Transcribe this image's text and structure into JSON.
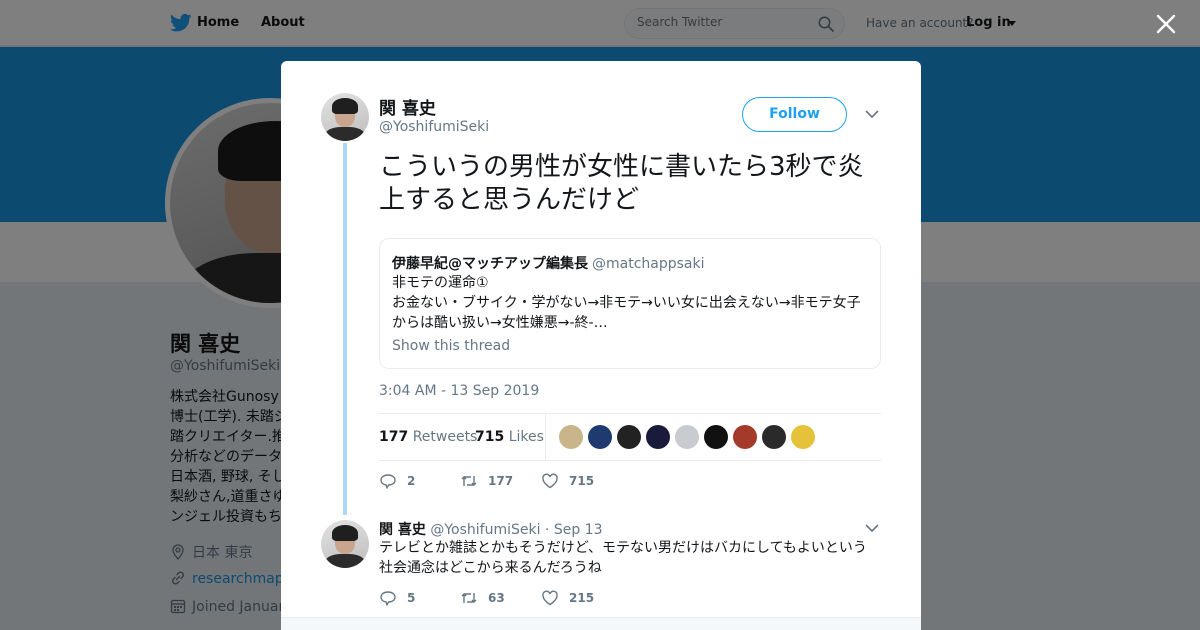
{
  "nav": {
    "home_label": "Home",
    "about_label": "About",
    "search_placeholder": "Search Twitter",
    "account_prompt": "Have an account?",
    "login_label": "Log in"
  },
  "profile": {
    "name": "関 喜史",
    "handle": "@YoshifumiSeki",
    "bio_lines": [
      "株式会社Gunosy 共",
      "博士(工学). 未踏ジ",
      "踏クリエイター.推",
      "分析などのデータ",
      "日本酒, 野球, そし",
      "梨紗さん,道重さゆ",
      "ンジェル投資もち"
    ],
    "location": "日本 東京",
    "url": "researchmap.jp",
    "joined": "Joined Januar"
  },
  "tweet": {
    "name": "関 喜史",
    "handle": "@YoshifumiSeki",
    "follow_label": "Follow",
    "text": "こういうの男性が女性に書いたら3秒で炎上すると思うんだけど",
    "quote": {
      "name": "伊藤早紀@マッチアップ編集長",
      "handle": "@matchappsaki",
      "lines": [
        "非モテの運命①",
        "お金ない・ブサイク・学がない→非モテ→いい女に出会えない→非モテ女子",
        "からは酷い扱い→女性嫌悪→-終-…"
      ],
      "show_thread": "Show this thread"
    },
    "timestamp": "3:04 AM - 13 Sep 2019",
    "retweets_count": "177",
    "retweets_label": "Retweets",
    "likes_count": "715",
    "likes_label": "Likes",
    "likers": [
      "#c9b58a",
      "#1f3a6e",
      "#222222",
      "#1a1a3a",
      "#c8ccd0",
      "#111111",
      "#a33a2a",
      "#2a2a2a",
      "#e5c23a"
    ],
    "actions": {
      "replies": "2",
      "retweets": "177",
      "likes": "715"
    }
  },
  "reply": {
    "name": "関 喜史",
    "handle": "@YoshifumiSeki",
    "date": "· Sep 13",
    "lines": [
      "テレビとか雑誌とかもそうだけど、モテない男だけはバカにしてもよいという",
      "社会通念はどこから来るんだろうね"
    ],
    "actions": {
      "replies": "5",
      "retweets": "63",
      "likes": "215"
    }
  }
}
